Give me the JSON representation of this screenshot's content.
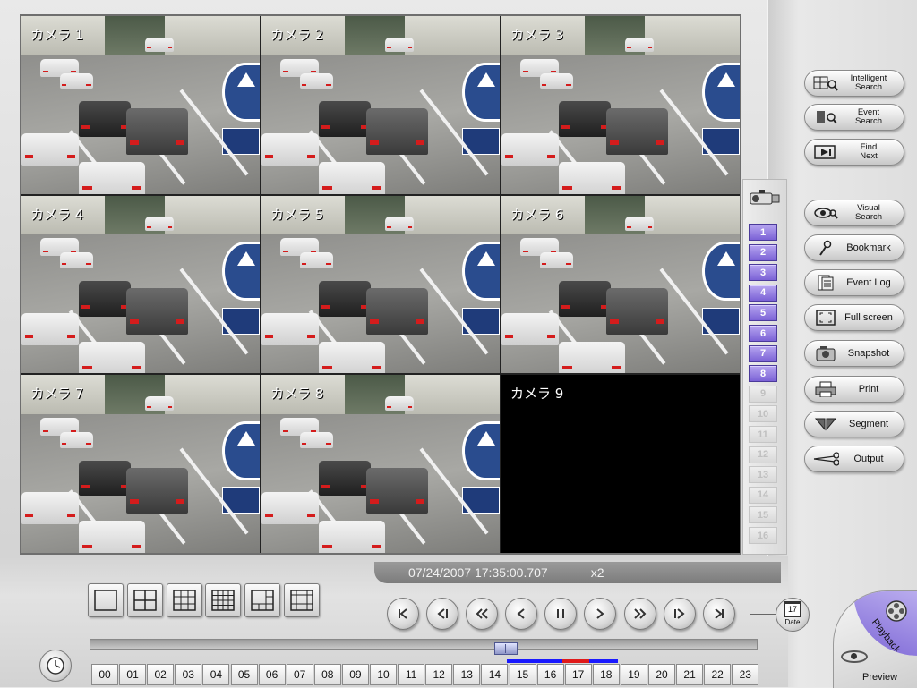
{
  "cameras": [
    {
      "label": "カメラ 1",
      "has_video": true
    },
    {
      "label": "カメラ 2",
      "has_video": true
    },
    {
      "label": "カメラ 3",
      "has_video": true
    },
    {
      "label": "カメラ 4",
      "has_video": true
    },
    {
      "label": "カメラ 5",
      "has_video": true
    },
    {
      "label": "カメラ 6",
      "has_video": true
    },
    {
      "label": "カメラ 7",
      "has_video": true
    },
    {
      "label": "カメラ 8",
      "has_video": true
    },
    {
      "label": "カメラ 9",
      "has_video": false
    }
  ],
  "side_buttons": {
    "intelligent_search": "Intelligent Search",
    "intelligent_search_l1": "Intelligent",
    "intelligent_search_l2": "Search",
    "event_search_l1": "Event",
    "event_search_l2": "Search",
    "find_next_l1": "Find",
    "find_next_l2": "Next",
    "visual_search_l1": "Visual",
    "visual_search_l2": "Search",
    "bookmark": "Bookmark",
    "event_log": "Event Log",
    "full_screen": "Full screen",
    "snapshot": "Snapshot",
    "print": "Print",
    "segment": "Segment",
    "output": "Output"
  },
  "channel_buttons": [
    "1",
    "2",
    "3",
    "4",
    "5",
    "6",
    "7",
    "8",
    "9",
    "10",
    "11",
    "12",
    "13",
    "14",
    "15",
    "16"
  ],
  "active_channels": 8,
  "timestamp": "07/24/2007 17:35:00.707",
  "speed": "x2",
  "date_button": {
    "day": "17",
    "label": "Date"
  },
  "hours": [
    "00",
    "01",
    "02",
    "03",
    "04",
    "05",
    "06",
    "07",
    "08",
    "09",
    "10",
    "11",
    "12",
    "13",
    "14",
    "15",
    "16",
    "17",
    "18",
    "19",
    "20",
    "21",
    "22",
    "23"
  ],
  "mode": {
    "playback": "Playback",
    "preview": "Preview"
  },
  "colors": {
    "accent_purple": "#7b62d6",
    "record_blue": "#1a1aff",
    "record_red": "#e01a1a"
  },
  "icons": {
    "layouts": [
      "layout-1x1-icon",
      "layout-2x2-icon",
      "layout-3x3-icon",
      "layout-4x4-icon",
      "layout-1plus5-icon",
      "layout-multi-icon"
    ],
    "playback": [
      "skip-start-icon",
      "step-back-icon",
      "fast-rewind-icon",
      "play-reverse-icon",
      "pause-icon",
      "play-icon",
      "fast-forward-icon",
      "step-forward-icon",
      "skip-end-icon"
    ]
  }
}
